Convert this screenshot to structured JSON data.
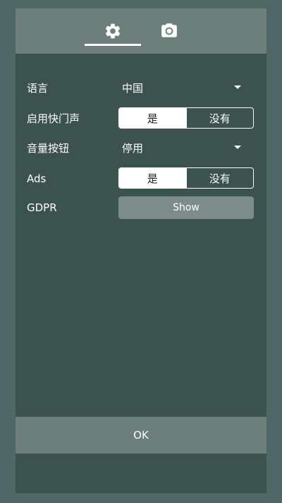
{
  "tabs": [
    {
      "icon": "gear-icon",
      "selected": true
    },
    {
      "icon": "camera-icon",
      "selected": false
    }
  ],
  "settings": {
    "language": {
      "label": "语言",
      "value": "中国"
    },
    "shutter_sound": {
      "label": "启用快门声",
      "on_label": "是",
      "off_label": "没有",
      "selected": "on"
    },
    "volume_button": {
      "label": "音量按钮",
      "value": "停用"
    },
    "ads": {
      "label": "Ads",
      "on_label": "是",
      "off_label": "没有",
      "selected": "on"
    },
    "gdpr": {
      "label": "GDPR",
      "button_label": "Show"
    }
  },
  "footer": {
    "ok_label": "OK"
  },
  "colors": {
    "background": "#4f6866",
    "panel": "#3b524f",
    "bar": "#6c7f7b",
    "button": "#7b8c89"
  }
}
